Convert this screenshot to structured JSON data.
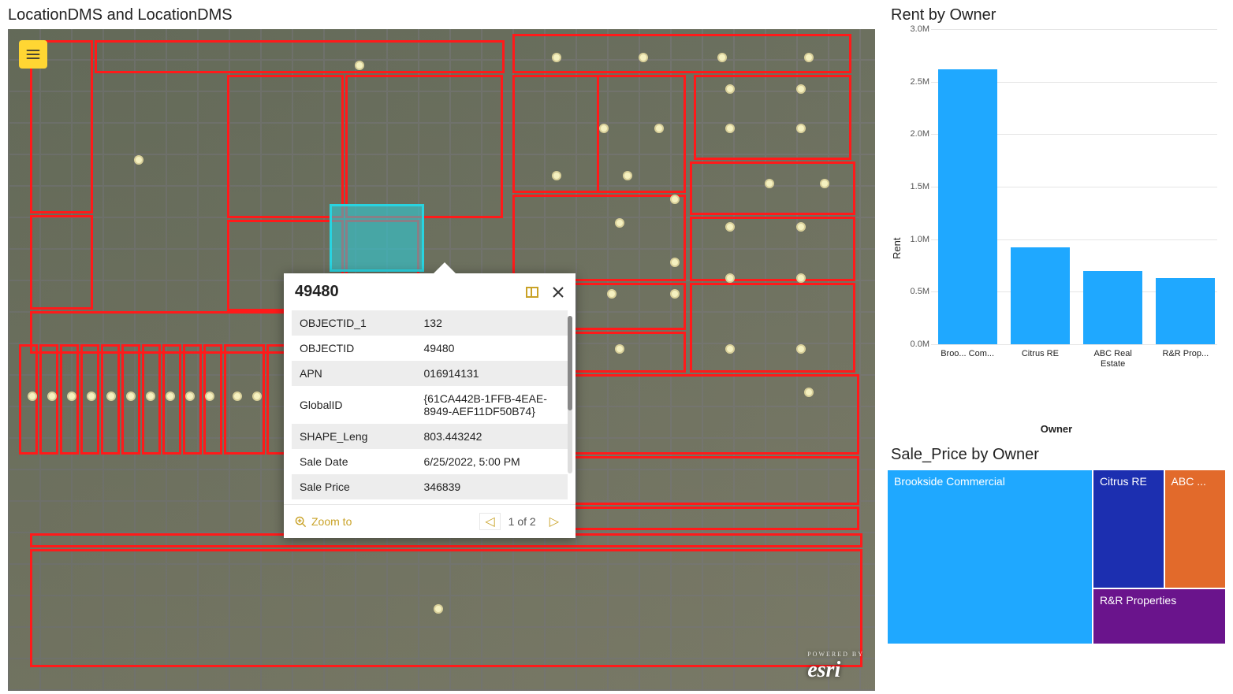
{
  "map": {
    "title": "LocationDMS and LocationDMS",
    "attribution_tag": "POWERED BY",
    "attribution": "esri"
  },
  "popup": {
    "title": "49480",
    "rows": [
      {
        "k": "OBJECTID_1",
        "v": "132"
      },
      {
        "k": "OBJECTID",
        "v": "49480"
      },
      {
        "k": "APN",
        "v": "016914131"
      },
      {
        "k": "GlobalID",
        "v": "{61CA442B-1FFB-4EAE-8949-AEF11DF50B74}"
      },
      {
        "k": "SHAPE_Leng",
        "v": "803.443242"
      },
      {
        "k": "Sale Date",
        "v": "6/25/2022, 5:00 PM"
      },
      {
        "k": "Sale Price",
        "v": "346839"
      }
    ],
    "zoom_label": "Zoom to",
    "pager": "1 of 2"
  },
  "chart_data": {
    "type": "bar",
    "title": "Rent by Owner",
    "ylabel": "Rent",
    "xlabel": "Owner",
    "ylim": [
      0,
      3000000
    ],
    "ticks": [
      {
        "v": 3000000,
        "label": "3.0M"
      },
      {
        "v": 2500000,
        "label": "2.5M"
      },
      {
        "v": 2000000,
        "label": "2.0M"
      },
      {
        "v": 1500000,
        "label": "1.5M"
      },
      {
        "v": 1000000,
        "label": "1.0M"
      },
      {
        "v": 500000,
        "label": "0.5M"
      },
      {
        "v": 0,
        "label": "0.0M"
      }
    ],
    "categories": [
      "Broo... Com...",
      "Citrus RE",
      "ABC Real Estate",
      "R&R Prop..."
    ],
    "values": [
      2620000,
      920000,
      700000,
      630000
    ]
  },
  "treemap": {
    "title": "Sale_Price by Owner",
    "cells": [
      {
        "label": "Brookside Commercial",
        "color": "#1fa8ff"
      },
      {
        "label": "Citrus RE",
        "color": "#1c2fb0"
      },
      {
        "label": "ABC ...",
        "color": "#e26a2b"
      },
      {
        "label": "R&R Properties",
        "color": "#6a148c"
      }
    ]
  }
}
